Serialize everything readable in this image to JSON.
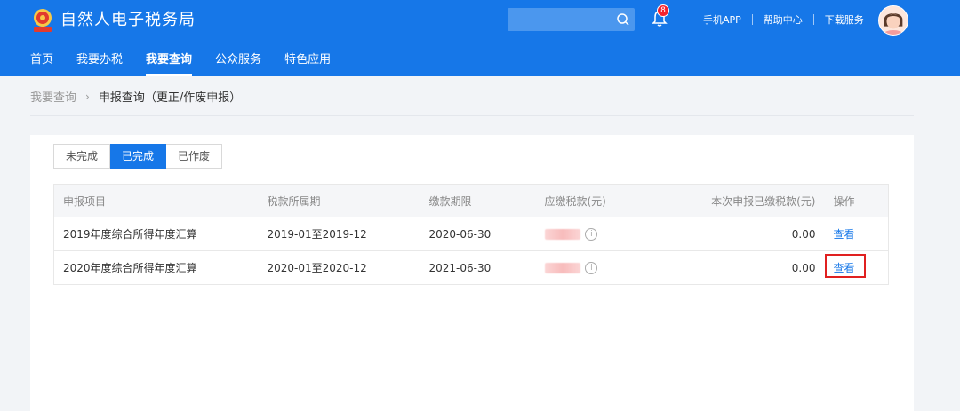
{
  "header": {
    "title": "自然人电子税务局",
    "search": {
      "placeholder": ""
    },
    "notification_count": "8",
    "links": [
      "手机APP",
      "帮助中心",
      "下载服务"
    ],
    "accent_color": "#1677e8"
  },
  "nav": {
    "items": [
      {
        "label": "首页",
        "active": false
      },
      {
        "label": "我要办税",
        "active": false
      },
      {
        "label": "我要查询",
        "active": true
      },
      {
        "label": "公众服务",
        "active": false
      },
      {
        "label": "特色应用",
        "active": false
      }
    ]
  },
  "breadcrumb": {
    "parent": "我要查询",
    "separator": "›",
    "current": "申报查询（更正/作废申报）"
  },
  "tabs": [
    {
      "label": "未完成",
      "active": false
    },
    {
      "label": "已完成",
      "active": true
    },
    {
      "label": "已作废",
      "active": false
    }
  ],
  "table": {
    "headers": [
      "申报项目",
      "税款所属期",
      "缴款期限",
      "应缴税款(元)",
      "本次申报已缴税款(元)",
      "操作"
    ],
    "rows": [
      {
        "item": "2019年度综合所得年度汇算",
        "period": "2019-01至2019-12",
        "deadline": "2020-06-30",
        "paid": "0.00",
        "action": "查看"
      },
      {
        "item": "2020年度综合所得年度汇算",
        "period": "2020-01至2020-12",
        "deadline": "2021-06-30",
        "paid": "0.00",
        "action": "查看"
      }
    ],
    "info_icon_glyph": "i",
    "paid_color": "#f04e0c",
    "highlight_color": "#e02020"
  }
}
